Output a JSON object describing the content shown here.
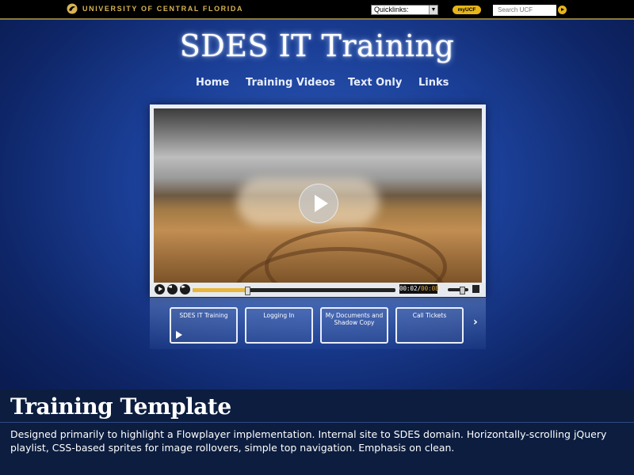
{
  "topbar": {
    "university_name": "UNIVERSITY OF CENTRAL FLORIDA",
    "quicklinks_value": "Quicklinks:",
    "myucf_label": "myUCF",
    "search_placeholder": "Search UCF",
    "accent_color": "#e7b519"
  },
  "header": {
    "title": "SDES IT Training",
    "nav": [
      "Home",
      "Training Videos",
      "Text Only",
      "Links"
    ]
  },
  "player": {
    "elapsed": "00:02",
    "duration": "00:08",
    "progress_fraction": 0.27,
    "volume_fraction": 0.7,
    "icons": [
      "play-icon",
      "rewind-icon",
      "fast-forward-icon",
      "fullscreen-icon"
    ]
  },
  "playlist": {
    "items": [
      "SDES IT Training",
      "Logging In",
      "My Documents and Shadow Copy",
      "Call Tickets"
    ],
    "next_label": "›"
  },
  "caption": {
    "title": "Training Template",
    "body": "Designed primarily to highlight a Flowplayer implementation. Internal site to SDES domain. Horizontally-scrolling jQuery playlist, CSS-based sprites for image rollovers, simple top navigation. Emphasis on clean."
  }
}
